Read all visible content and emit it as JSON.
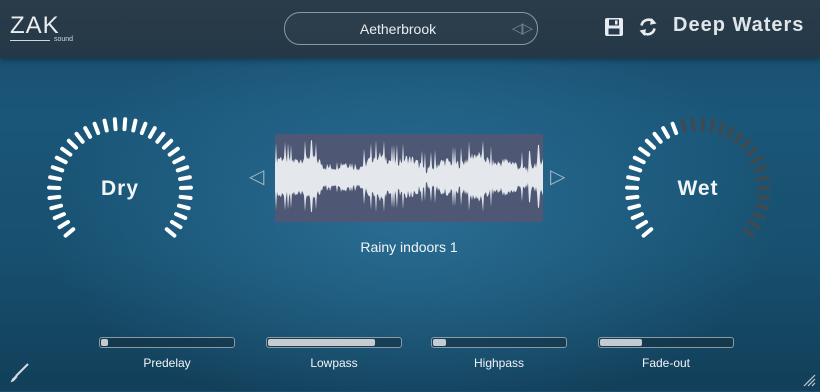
{
  "header": {
    "logo_text": "ZAK",
    "logo_sub": "sound",
    "preset_name": "Aetherbrook",
    "product_title": "Deep Waters",
    "icons": [
      "save-icon",
      "refresh-icon",
      "preset-prev-icon",
      "preset-next-icon"
    ]
  },
  "knobs": {
    "dry": {
      "label": "Dry",
      "level": 1.0
    },
    "wet": {
      "label": "Wet",
      "level": 0.45
    }
  },
  "sample": {
    "name": "Rainy indoors 1"
  },
  "sliders": [
    {
      "label": "Predelay",
      "value": 0.05
    },
    {
      "label": "Lowpass",
      "value": 0.81
    },
    {
      "label": "Highpass",
      "value": 0.1
    },
    {
      "label": "Fade-out",
      "value": 0.32
    }
  ],
  "colors": {
    "accent": "#ffffff",
    "inactive_tick": "#3e4a52",
    "waveform_bg": "#4e5875",
    "waveform_fg": "#e4e8ec"
  }
}
